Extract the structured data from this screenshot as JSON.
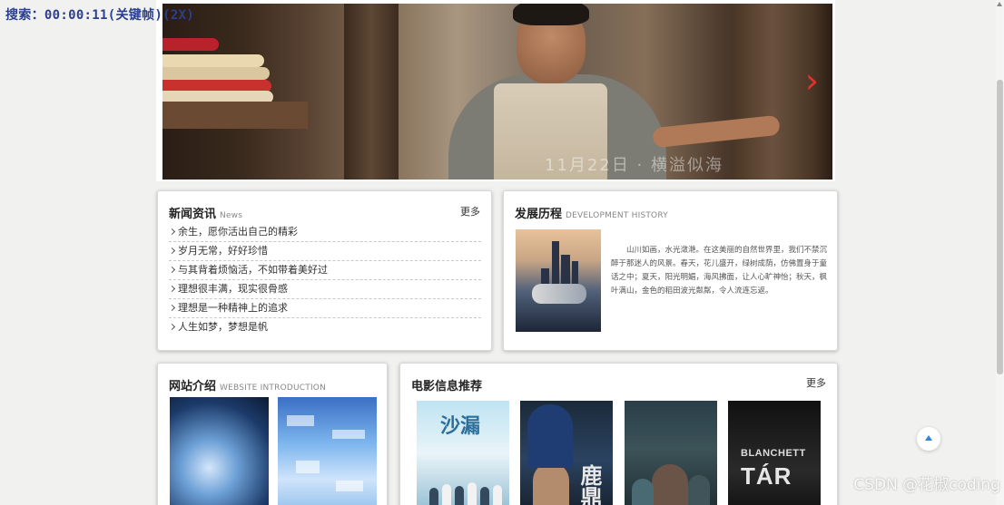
{
  "overlay": {
    "search_timer": "搜索：00:00:11(关键帧)(2X)"
  },
  "banner": {
    "caption": "11月22日 · 横溢似海",
    "next_arrow": "›",
    "accent_color": "#e0312c"
  },
  "news": {
    "title": "新闻资讯",
    "subtitle": "News",
    "more": "更多",
    "items": [
      "余生，愿你活出自己的精彩",
      "岁月无常，好好珍惜",
      "与其背着烦恼活，不如带着美好过",
      "理想很丰满，现实很骨感",
      "理想是一种精神上的追求",
      "人生如梦，梦想是帆"
    ]
  },
  "history": {
    "title": "发展历程",
    "subtitle": "DEVELOPMENT HISTORY",
    "text": "山川如画，水光潋滟。在这美丽的自然世界里，我们不禁沉醉于那迷人的风景。春天，花儿盛开，绿树成荫，仿佛置身于童话之中；夏天，阳光明媚，海风拂面，让人心旷神怡；秋天，枫叶满山，金色的稻田波光粼粼，令人流连忘返。"
  },
  "site_intro": {
    "title": "网站介绍",
    "subtitle": "WEBSITE INTRODUCTION"
  },
  "movies": {
    "title": "电影信息推荐",
    "more": "更多",
    "posters": [
      {
        "title": "沙漏"
      },
      {
        "title": "鹿鼎"
      },
      {
        "title": ""
      },
      {
        "title": "TÁR",
        "subtitle": "BLANCHETT"
      }
    ]
  },
  "watermark": "CSDN @花椒coding",
  "back_to_top": {
    "icon": "arrow-up-icon",
    "color": "#2f86d6"
  }
}
